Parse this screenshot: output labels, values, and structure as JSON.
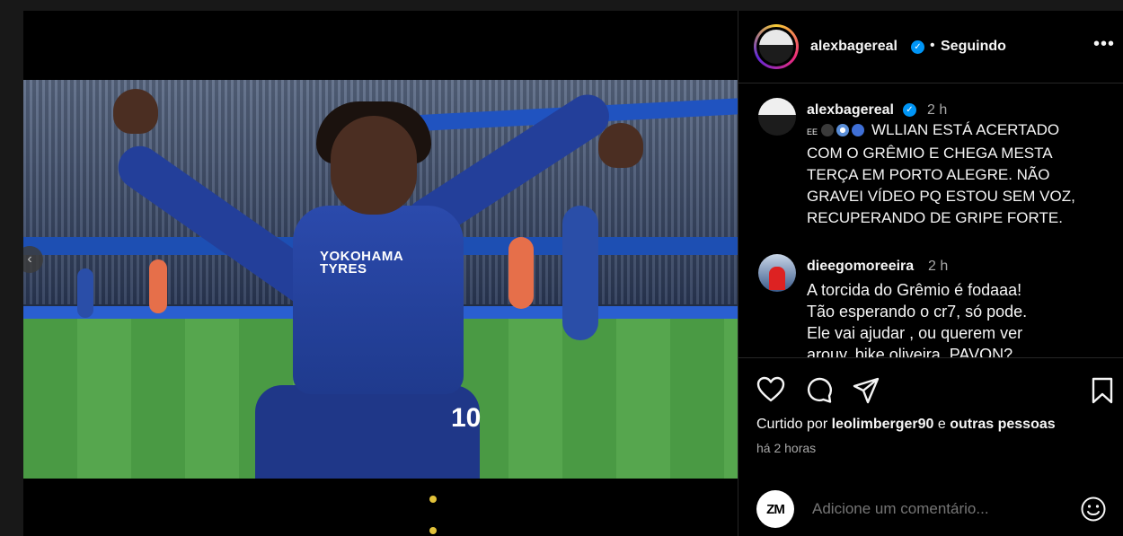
{
  "media": {
    "sponsor_text": "YOKOHAMA\nTYRES",
    "shirt_number": "10",
    "nav_prev_icon": "chevron-left-icon",
    "nav_next_icon": "chevron-right-icon"
  },
  "header": {
    "username": "alexbagereal",
    "separator": "•",
    "follow_status": "Seguindo",
    "more_icon": "•••"
  },
  "caption": {
    "username": "alexbagereal",
    "time": "2 h",
    "prefix": "EE",
    "text": "WLLIAN ESTÁ ACERTADO\nCOM O GRÊMIO E CHEGA MESTA\nTERÇA EM PORTO ALEGRE. NÃO\nGRAVEI VÍDEO PQ ESTOU SEM VOZ,\nRECUPERANDO DE GRIPE FORTE."
  },
  "comments": [
    {
      "username": "dieegomoreeira",
      "time": "2 h",
      "text": "A torcida do Grêmio é fodaaa!\nTão esperando o cr7, só pode.\nEle vai ajudar , ou querem ver\narouy, bike oliveira, PAVON?"
    }
  ],
  "likes": {
    "prefix": "Curtido por",
    "user": "leolimberger90",
    "connector": "e",
    "others": "outras pessoas"
  },
  "time_ago": "há 2 horas",
  "add_comment": {
    "avatar_text": "ZM",
    "placeholder": "Adicione um comentário..."
  },
  "colors": {
    "background": "#000000",
    "verified": "#0095f6",
    "muted_text": "#a8a8a8"
  }
}
